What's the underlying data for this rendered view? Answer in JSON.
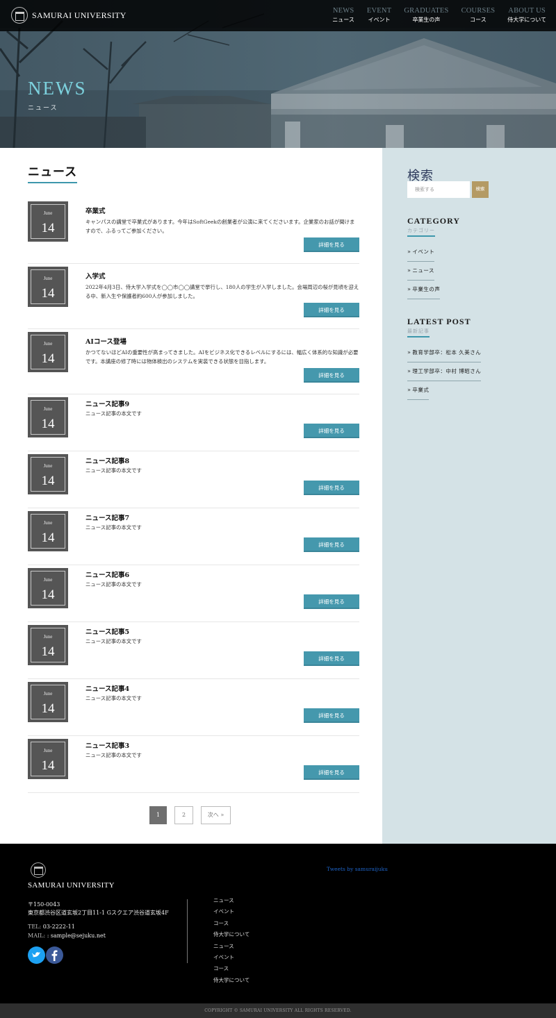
{
  "header": {
    "brand": "SAMURAI UNIVERSITY",
    "nav": [
      {
        "en": "NEWS",
        "ja": "ニュース"
      },
      {
        "en": "EVENT",
        "ja": "イベント"
      },
      {
        "en": "GRADUATES",
        "ja": "卒業生の声"
      },
      {
        "en": "COURSES",
        "ja": "コース"
      },
      {
        "en": "ABOUT US",
        "ja": "侍大学について"
      }
    ],
    "hero_title": "NEWS",
    "hero_subtitle": "ニュース"
  },
  "main": {
    "section_title": "ニュース",
    "more_label": "詳細を見る",
    "posts": [
      {
        "month": "June",
        "day": "14",
        "title": "卒業式",
        "body": "キャンパスの講堂で卒業式があります。今年はSoftGeekの創業者が公演に来てくださいます。企業家のお話が聞けますので、ふるってご参加ください。"
      },
      {
        "month": "June",
        "day": "14",
        "title": "入学式",
        "body": "2022年4月3日、侍大学入学式を◯◯市◯◯講堂で挙行し、180人の学生が入学しました。会場周辺の桜が見頃を迎える中、新入生や保護者約600人が参加しました。"
      },
      {
        "month": "June",
        "day": "14",
        "title": "AIコース登場",
        "body": "かつてないほどAIの重要性が高まってきました。AIをビジネス化できるレベルにするには、幅広く体系的な知識が必要です。本講座の修了時には物体検出のシステムを実装できる状態を目指します。"
      },
      {
        "month": "June",
        "day": "14",
        "title": "ニュース記事9",
        "body": "ニュース記事の本文です"
      },
      {
        "month": "June",
        "day": "14",
        "title": "ニュース記事8",
        "body": "ニュース記事の本文です"
      },
      {
        "month": "June",
        "day": "14",
        "title": "ニュース記事7",
        "body": "ニュース記事の本文です"
      },
      {
        "month": "June",
        "day": "14",
        "title": "ニュース記事6",
        "body": "ニュース記事の本文です"
      },
      {
        "month": "June",
        "day": "14",
        "title": "ニュース記事5",
        "body": "ニュース記事の本文です"
      },
      {
        "month": "June",
        "day": "14",
        "title": "ニュース記事4",
        "body": "ニュース記事の本文です"
      },
      {
        "month": "June",
        "day": "14",
        "title": "ニュース記事3",
        "body": "ニュース記事の本文です"
      }
    ],
    "pagination": {
      "pages": [
        "1",
        "2"
      ],
      "current": "1",
      "next": "次へ »"
    }
  },
  "sidebar": {
    "search_title": "検索",
    "search_placeholder": "検索する",
    "search_button": "検索",
    "category_title": "CATEGORY",
    "category_sub": "カテゴリー",
    "categories": [
      "イベント",
      "ニュース",
      "卒業生の声"
    ],
    "latest_title": "LATEST POST",
    "latest_sub": "最新記事",
    "latest": [
      "教育学部卒：松本 久美さん",
      "理工学部卒：中村 博昭さん",
      "卒業式"
    ]
  },
  "footer": {
    "name": "SAMURAI UNIVERSITY",
    "postal": "〒150-0043",
    "address": "東京都渋谷区道玄坂2丁目11-1 Gスクエア渋谷道玄坂4F",
    "tel_label": "TEL:",
    "tel": "03-2222-11",
    "mail_label": "MAIL:",
    "mail": ": sample@sejuku.net",
    "links": [
      "ニュース",
      "イベント",
      "コース",
      "侍大学について",
      "ニュース",
      "イベント",
      "コース",
      "侍大学について"
    ],
    "tweets": "Tweets by samuraijuku",
    "copyright": "COPYRIGHT © SAMURAI UNIVERSITY ALL RIGHTS RESERVED."
  },
  "colors": {
    "accent": "#4598ad",
    "sidebar_bg": "#d4e2e6",
    "search_button": "#b49a64",
    "hero_title": "#7dd2de",
    "date_box": "#555555"
  },
  "icons": [
    "university-logo-icon",
    "chevron-right-icon",
    "twitter-icon",
    "facebook-icon"
  ]
}
